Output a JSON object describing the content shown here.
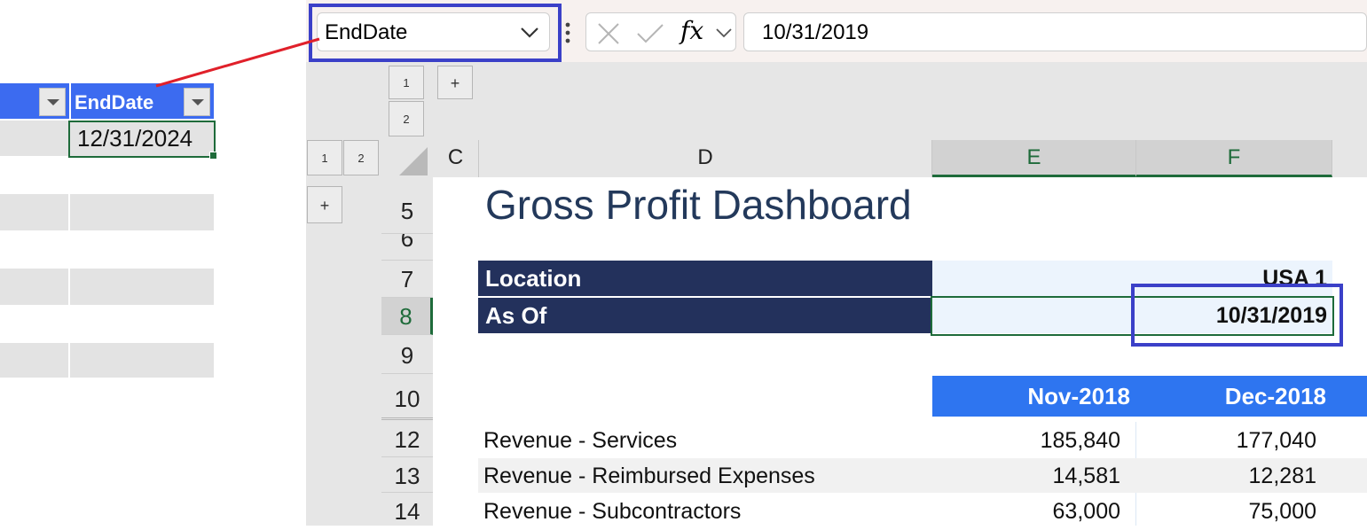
{
  "left_table": {
    "header_label": "EndDate",
    "selected_value": "12/31/2024"
  },
  "formula_bar": {
    "name_box": "EndDate",
    "fx_label": "fx",
    "value": "10/31/2019"
  },
  "outline": {
    "row_levels": [
      "1",
      "2"
    ],
    "col_levels": [
      "1",
      "2"
    ],
    "expand": "+"
  },
  "columns": [
    "C",
    "D",
    "E",
    "F"
  ],
  "rows": [
    "5",
    "6",
    "7",
    "8",
    "9",
    "10",
    "12",
    "13",
    "14"
  ],
  "sheet": {
    "title": "Gross Profit Dashboard",
    "location_label": "Location",
    "location_value": "USA 1",
    "asof_label": "As Of",
    "asof_value": "10/31/2019",
    "months": [
      "Nov-2018",
      "Dec-2018"
    ],
    "lines": [
      {
        "label": "Revenue - Services",
        "values": [
          "185,840",
          "177,040"
        ]
      },
      {
        "label": "Revenue - Reimbursed Expenses",
        "values": [
          "14,581",
          "12,281"
        ]
      },
      {
        "label": "Revenue - Subcontractors",
        "values": [
          "63,000",
          "75,000"
        ]
      }
    ]
  },
  "colors": {
    "highlight_frame": "#3b40c8",
    "arrow": "#e0202a",
    "navy": "#23315c",
    "header_blue": "#2e75f0",
    "selection_green": "#1e6b3a"
  }
}
